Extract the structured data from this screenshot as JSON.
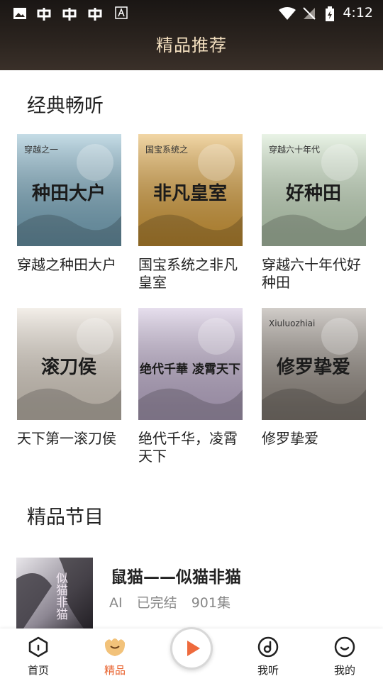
{
  "status_bar": {
    "time": "4:12"
  },
  "header": {
    "title": "精品推荐"
  },
  "section_classic": {
    "title": "经典畅听"
  },
  "books": [
    {
      "title": "穿越之种田大户",
      "cover_text": "种田大户",
      "cover_sub": "穿越之一",
      "cover_color": "#7fb2c9"
    },
    {
      "title": "国宝系统之非凡皇室",
      "cover_text": "非凡皇室",
      "cover_sub": "国宝系统之",
      "cover_color": "#e2a53a"
    },
    {
      "title": "穿越六十年代好种田",
      "cover_text": "好种田",
      "cover_sub": "穿越六十年代",
      "cover_color": "#cfe6c8"
    },
    {
      "title": "天下第一滚刀侯",
      "cover_text": "滚刀侯",
      "cover_sub": "",
      "cover_color": "#e6dccf"
    },
    {
      "title": "绝代千华，凌霄天下",
      "cover_text": "绝代千華 凌霄天下",
      "cover_sub": "",
      "cover_color": "#c9b8d8"
    },
    {
      "title": "修罗挚爱",
      "cover_text": "修罗挚爱",
      "cover_sub": "Xiuluozhiai",
      "cover_color": "#9a9188"
    }
  ],
  "section_programs": {
    "title": "精品节目"
  },
  "program": {
    "title": "鼠猫——似猫非猫",
    "author": "AI",
    "status": "已完结",
    "episodes": "901集",
    "cover_text": "似猫非猫"
  },
  "tabs": [
    {
      "label": "首页",
      "icon": "home-icon",
      "active": false
    },
    {
      "label": "精品",
      "icon": "premium-icon",
      "active": true
    },
    {
      "label": "我听",
      "icon": "headphone-disc-icon",
      "active": false
    },
    {
      "label": "我的",
      "icon": "profile-face-icon",
      "active": false
    }
  ],
  "colors": {
    "accent": "#e8612c",
    "header_title": "#f3dfbf"
  }
}
